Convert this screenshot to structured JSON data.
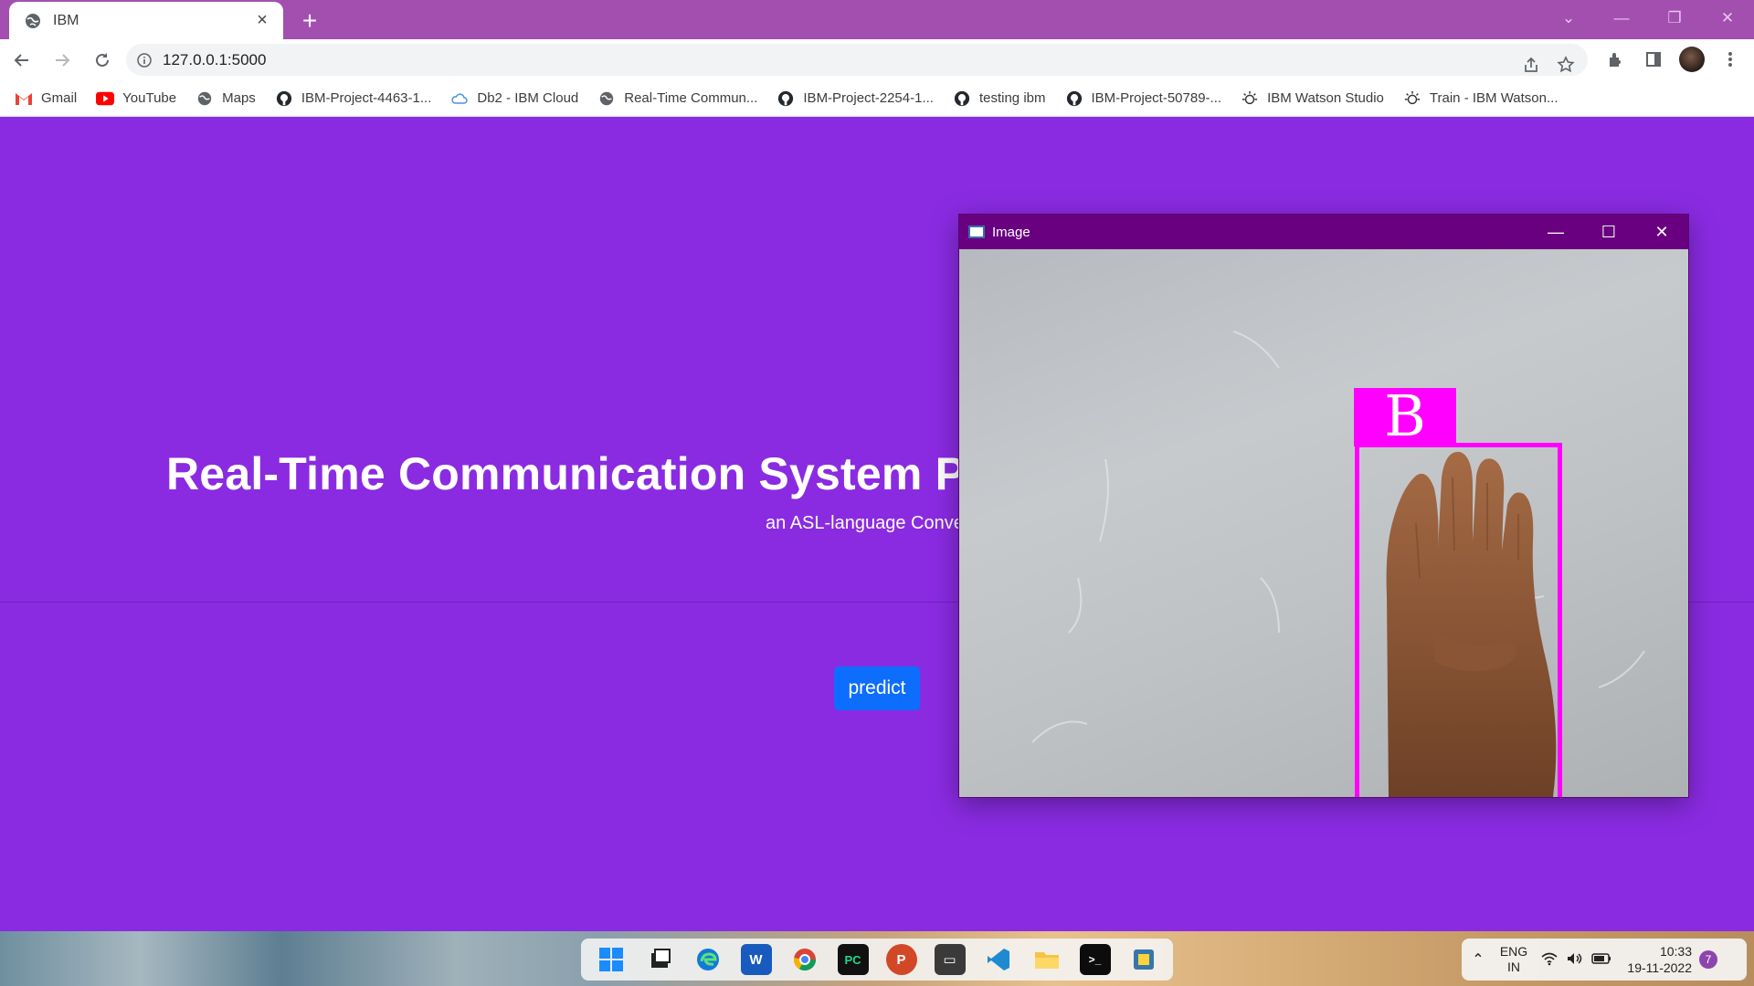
{
  "browser": {
    "tab_title": "IBM",
    "url": "127.0.0.1:5000",
    "bookmarks": [
      {
        "label": "Gmail",
        "icon": "gmail-icon"
      },
      {
        "label": "YouTube",
        "icon": "youtube-icon"
      },
      {
        "label": "Maps",
        "icon": "globe-icon"
      },
      {
        "label": "IBM-Project-4463-1...",
        "icon": "github-icon"
      },
      {
        "label": "Db2 - IBM Cloud",
        "icon": "cloud-icon"
      },
      {
        "label": "Real-Time Commun...",
        "icon": "globe-icon"
      },
      {
        "label": "IBM-Project-2254-1...",
        "icon": "github-icon"
      },
      {
        "label": "testing ibm",
        "icon": "github-icon"
      },
      {
        "label": "IBM-Project-50789-...",
        "icon": "github-icon"
      },
      {
        "label": "IBM Watson Studio",
        "icon": "watson-icon"
      },
      {
        "label": "Train - IBM Watson...",
        "icon": "watson-icon"
      }
    ]
  },
  "page": {
    "hero_title": "Real-Time Communication System Pov",
    "hero_subtitle": "an ASL-language Conve",
    "predict_label": "predict"
  },
  "cv_window": {
    "title": "Image",
    "prediction": "B"
  },
  "taskbar": {
    "apps": [
      "start",
      "task-view",
      "edge",
      "word",
      "chrome",
      "pycharm",
      "powerpoint",
      "terminal-app",
      "vscode",
      "file-explorer",
      "cmd",
      "python"
    ],
    "lang_line1": "ENG",
    "lang_line2": "IN",
    "time": "10:33",
    "date": "19-11-2022",
    "notification_count": "7"
  },
  "colors": {
    "page_bg": "#8a2be2",
    "tabstrip": "#a34fb0",
    "button": "#0d6efd",
    "detection": "#ff00ff",
    "cv_titlebar": "#68007f"
  }
}
